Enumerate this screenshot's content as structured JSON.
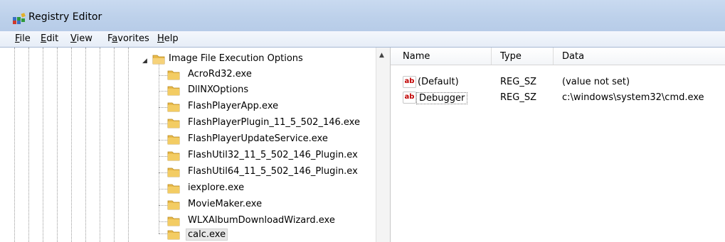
{
  "window": {
    "title": "Registry Editor"
  },
  "menu": [
    {
      "label": "File"
    },
    {
      "label": "Edit"
    },
    {
      "label": "View"
    },
    {
      "label": "Favorites"
    },
    {
      "label": "Help"
    }
  ],
  "tree": {
    "parent": {
      "label": "Image File Execution Options",
      "expanded": true
    },
    "children": [
      {
        "label": "AcroRd32.exe"
      },
      {
        "label": "DllNXOptions"
      },
      {
        "label": "FlashPlayerApp.exe"
      },
      {
        "label": "FlashPlayerPlugin_11_5_502_146.exe"
      },
      {
        "label": "FlashPlayerUpdateService.exe"
      },
      {
        "label": "FlashUtil32_11_5_502_146_Plugin.ex"
      },
      {
        "label": "FlashUtil64_11_5_502_146_Plugin.ex"
      },
      {
        "label": "iexplore.exe"
      },
      {
        "label": "MovieMaker.exe"
      },
      {
        "label": "WLXAlbumDownloadWizard.exe"
      },
      {
        "label": "calc.exe",
        "selected": true
      }
    ]
  },
  "list": {
    "columns": {
      "name": "Name",
      "type": "Type",
      "data": "Data"
    },
    "rows": [
      {
        "icon": "ab",
        "name": "(Default)",
        "type": "REG_SZ",
        "data": "(value not set)"
      },
      {
        "icon": "ab",
        "name": "Debugger",
        "type": "REG_SZ",
        "data": "c:\\windows\\system32\\cmd.exe"
      }
    ]
  },
  "colors": {
    "titlebar": "#bcd0ea",
    "folder": "#e8b94a",
    "ab_icon": "#c00000"
  }
}
